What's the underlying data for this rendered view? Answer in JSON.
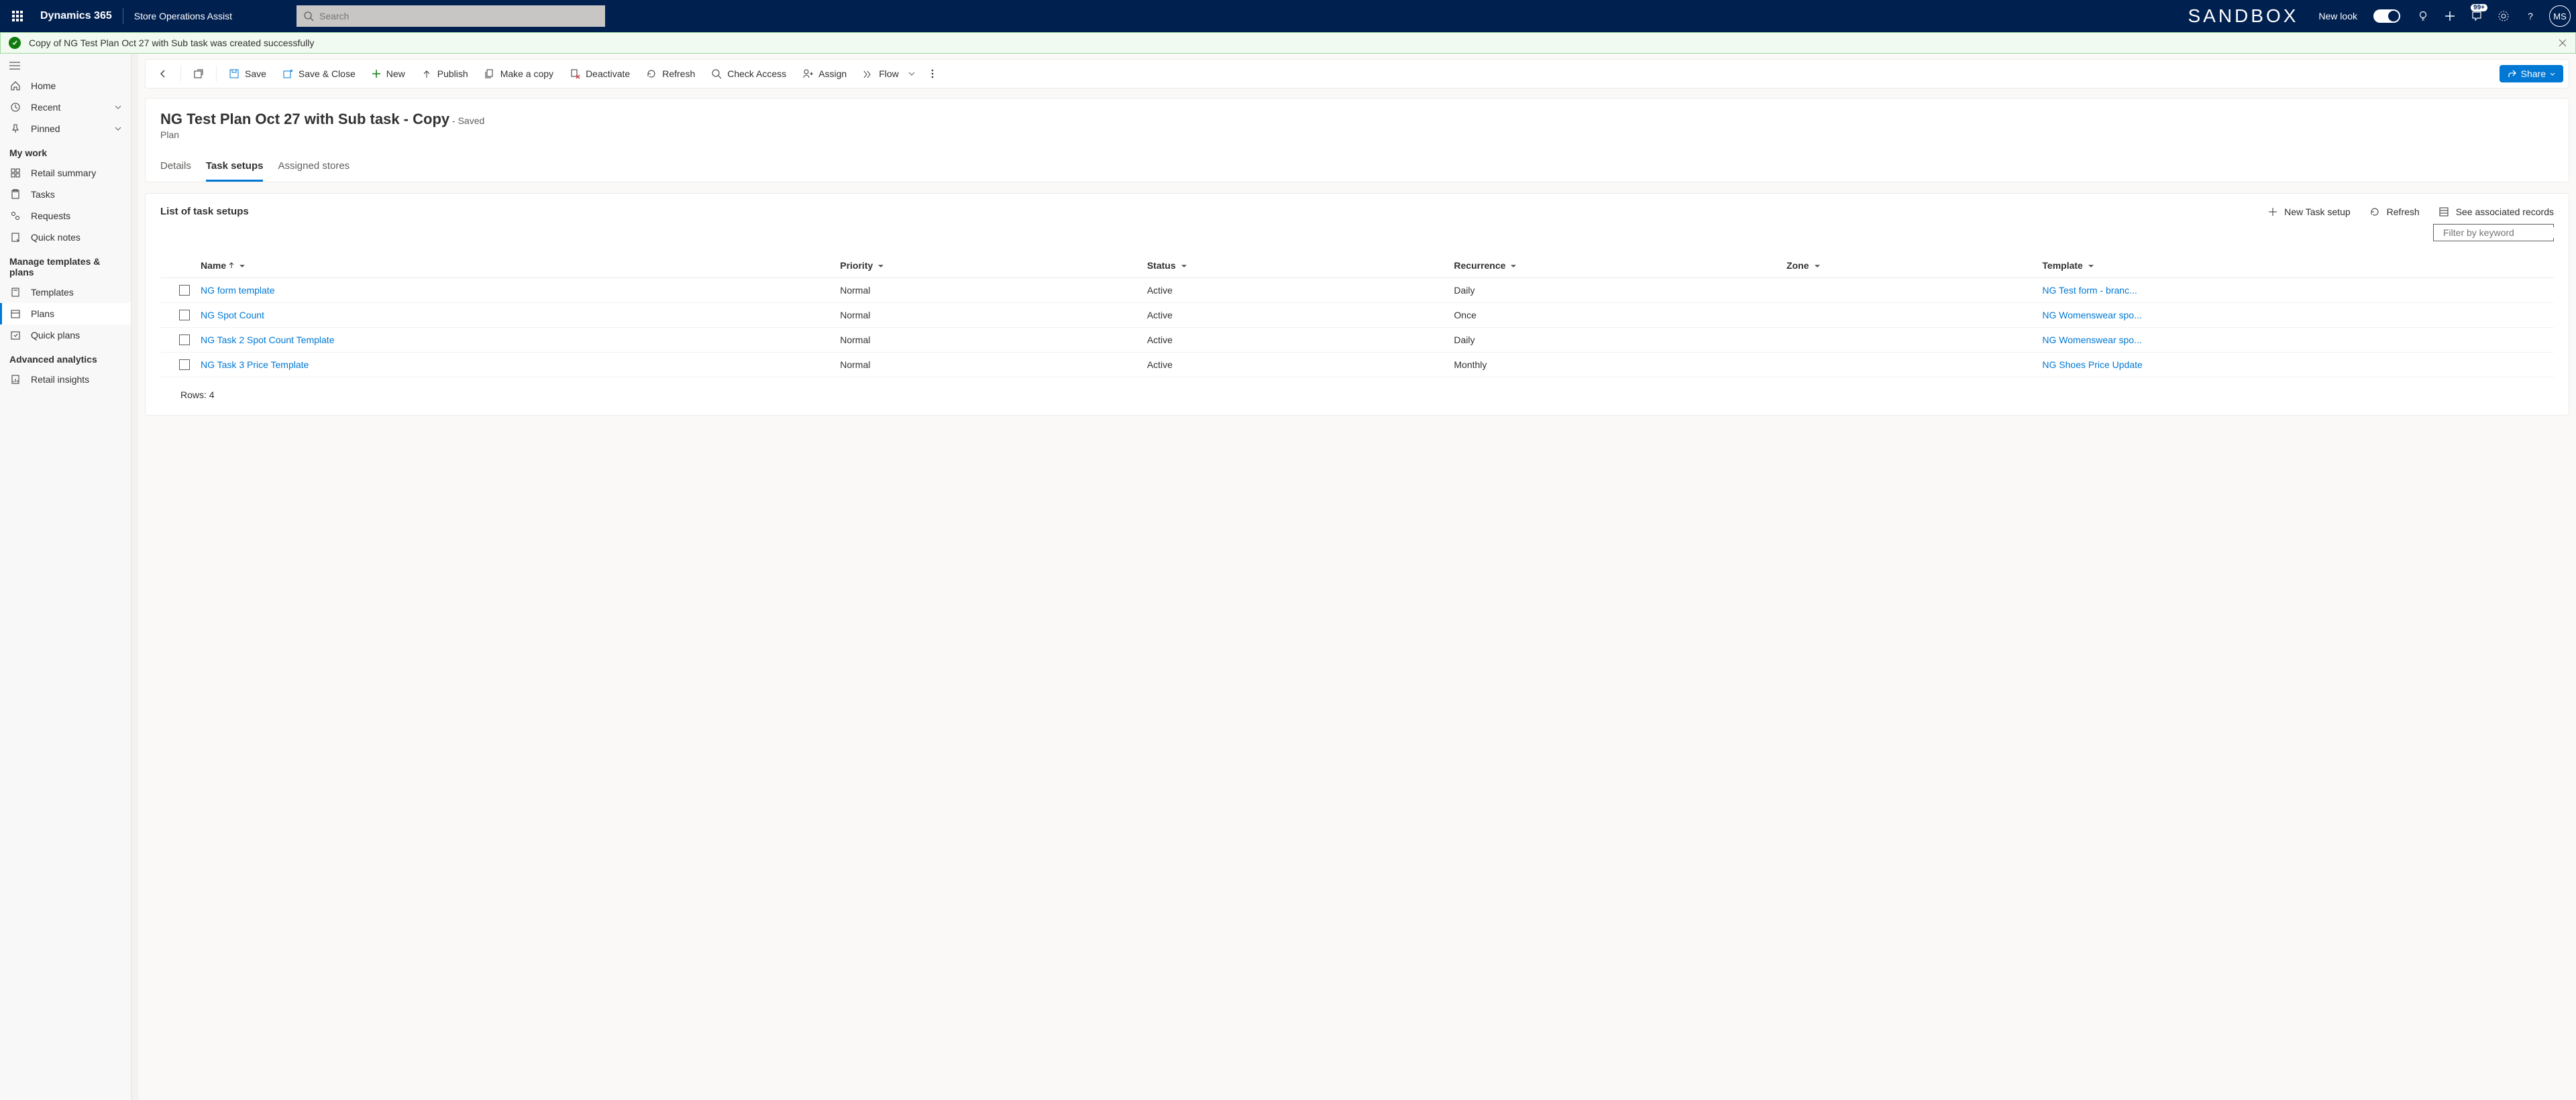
{
  "topbar": {
    "brand": "Dynamics 365",
    "app": "Store Operations Assist",
    "search_placeholder": "Search",
    "sandbox": "SANDBOX",
    "newlook": "New look",
    "avatar": "MS",
    "badge": "99+"
  },
  "banner": {
    "message": "Copy of NG Test Plan Oct 27 with Sub task was created successfully"
  },
  "sidebar": {
    "home": "Home",
    "recent": "Recent",
    "pinned": "Pinned",
    "section_mywork": "My work",
    "retail_summary": "Retail summary",
    "tasks": "Tasks",
    "requests": "Requests",
    "quicknotes": "Quick notes",
    "section_templates": "Manage templates & plans",
    "templates": "Templates",
    "plans": "Plans",
    "quickplans": "Quick plans",
    "section_analytics": "Advanced analytics",
    "retailinsights": "Retail insights"
  },
  "commands": {
    "save": "Save",
    "saveclose": "Save & Close",
    "new": "New",
    "publish": "Publish",
    "makecopy": "Make a copy",
    "deactivate": "Deactivate",
    "refresh": "Refresh",
    "checkaccess": "Check Access",
    "assign": "Assign",
    "flow": "Flow",
    "share": "Share"
  },
  "header": {
    "title": "NG Test Plan Oct 27 with Sub task - Copy",
    "saved": "- Saved",
    "subtitle": "Plan"
  },
  "tabs": {
    "details": "Details",
    "tasksetups": "Task setups",
    "assigned": "Assigned stores"
  },
  "list": {
    "title": "List of task setups",
    "new_task": "New Task setup",
    "refresh": "Refresh",
    "see_assoc": "See associated records",
    "filter_placeholder": "Filter by keyword"
  },
  "grid": {
    "cols": {
      "name": "Name",
      "priority": "Priority",
      "status": "Status",
      "recurrence": "Recurrence",
      "zone": "Zone",
      "template": "Template"
    },
    "rows": [
      {
        "name": "NG form template",
        "priority": "Normal",
        "status": "Active",
        "recurrence": "Daily",
        "zone": "",
        "template": "NG Test form - branc..."
      },
      {
        "name": "NG Spot Count",
        "priority": "Normal",
        "status": "Active",
        "recurrence": "Once",
        "zone": "",
        "template": "NG Womenswear spo..."
      },
      {
        "name": "NG Task 2 Spot Count Template",
        "priority": "Normal",
        "status": "Active",
        "recurrence": "Daily",
        "zone": "",
        "template": "NG Womenswear spo..."
      },
      {
        "name": "NG Task 3 Price Template",
        "priority": "Normal",
        "status": "Active",
        "recurrence": "Monthly",
        "zone": "",
        "template": "NG Shoes Price Update"
      }
    ],
    "rowcount": "Rows: 4"
  }
}
